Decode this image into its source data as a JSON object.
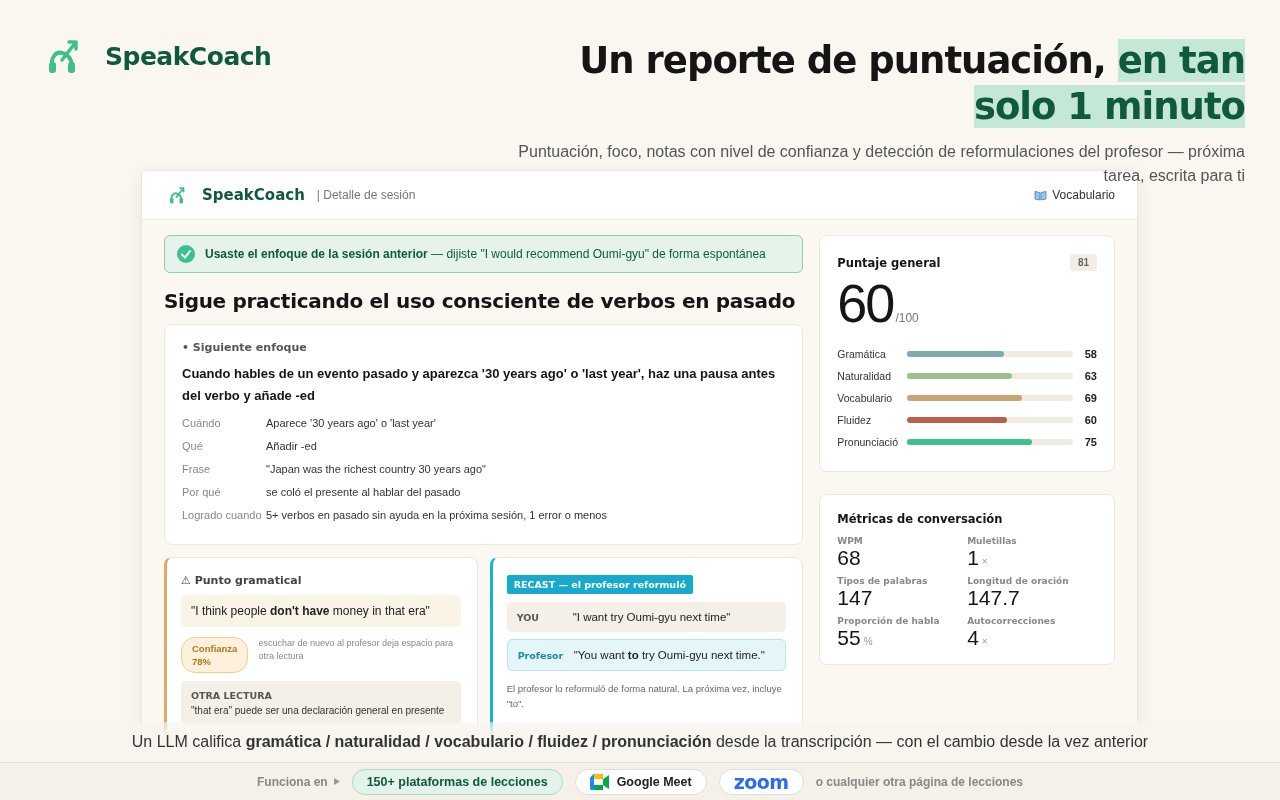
{
  "brand": {
    "name": "SpeakCoach"
  },
  "hero": {
    "headline": "Un reporte de puntuación, ",
    "headline_highlight": "en tan solo 1 minuto",
    "subtitle": "Puntuación, foco, notas con nivel de confianza y detección de reformulaciones del profesor — próxima tarea, escrita para ti"
  },
  "app": {
    "brand": "SpeakCoach",
    "breadcrumb": "| Detalle de sesión",
    "nav_link": "Vocabulario",
    "banner": "**Usaste el enfoque de la sesión anterior** — dijiste \"I would recommend Oumi-gyu\" de forma espontánea",
    "title": "Sigue practicando el uso consciente de verbos en pasado",
    "focus": {
      "label": "• Siguiente enfoque",
      "heading": "Cuando hables de un evento pasado y aparezca '30 years ago' o 'last year', haz una pausa antes del verbo y añade -ed",
      "rows": [
        {
          "key": "Cuándo",
          "value": "Aparece '30 years ago' o 'last year'"
        },
        {
          "key": "Qué",
          "value": "Añadir -ed"
        },
        {
          "key": "Frase",
          "value": "\"Japan was the richest country 30 years ago\""
        },
        {
          "key": "Por qué",
          "value": "se coló el presente al hablar del pasado"
        },
        {
          "key": "Logrado cuando",
          "value": "5+ verbos en pasado sin ayuda en la próxima sesión, 1 error o menos"
        }
      ]
    },
    "grammar": {
      "title": "⚠ Punto gramatical",
      "quote": "\"I think people **don't have** money in that era\"",
      "confidence": "Confianza 78%",
      "note": "escuchar de nuevo al profesor deja espacio para otra lectura",
      "alt_label": "OTRA LECTURA",
      "alt_text": "\"that era\" puede ser una declaración general en presente"
    },
    "recast": {
      "badge": "RECAST — el profesor reformuló",
      "lines": [
        {
          "kind": "student",
          "speaker": "YOU",
          "text": "\"I want try Oumi-gyu next time\""
        },
        {
          "kind": "teacher",
          "speaker": "Profesor",
          "text": "\"You want **to** try Oumi-gyu next time.\""
        }
      ],
      "note": "El profesor lo reformuló de forma natural. La próxima vez, incluye \"to\"."
    },
    "score": {
      "title": "Puntaje general",
      "badge": "81",
      "value": "60",
      "max": "/100",
      "categories": [
        {
          "label": "Gramática",
          "level": 0.58,
          "score": "58",
          "color": "#7aadad"
        },
        {
          "label": "Naturalidad",
          "level": 0.63,
          "score": "63",
          "color": "#9cc08a"
        },
        {
          "label": "Vocabulario",
          "level": 0.69,
          "score": "69",
          "color": "#c9a574"
        },
        {
          "label": "Fluidez",
          "level": 0.6,
          "score": "60",
          "color": "#b86050"
        },
        {
          "label": "Pronunciació",
          "level": 0.75,
          "score": "75",
          "color": "#3dbf8e"
        }
      ]
    },
    "metrics": {
      "title": "Métricas de conversación",
      "items": [
        {
          "label": "WPM",
          "value": "68"
        },
        {
          "label": "Muletillas",
          "value": "1",
          "unit": "×"
        },
        {
          "label": "Tipos de palabras",
          "value": "147"
        },
        {
          "label": "Longitud de oración",
          "value": "147.7"
        },
        {
          "label": "Proporción de habla",
          "value": "55",
          "unit": "%"
        },
        {
          "label": "Autocorrecciones",
          "value": "4",
          "unit": "×"
        }
      ]
    }
  },
  "caption": "Un LLM califica **gramática / naturalidad / vocabulario / fluidez / pronunciación** desde la transcripción — con el cambio desde la vez anterior",
  "footer": {
    "lead": "Funciona en",
    "platforms": [
      {
        "kind": "tag",
        "label": "150+ plataformas de lecciones"
      },
      {
        "kind": "meet",
        "label": "Google Meet"
      },
      {
        "kind": "wordmark",
        "label": "zoom"
      }
    ],
    "trail": "o cualquier otra página de lecciones"
  }
}
